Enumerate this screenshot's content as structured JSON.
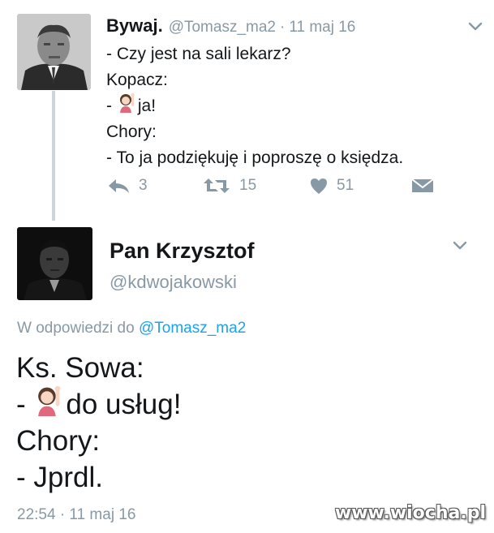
{
  "colors": {
    "text": "#14171a",
    "muted": "#8899a6",
    "link": "#1da1f2",
    "thread_line": "#ccd6dd"
  },
  "parent_tweet": {
    "display_name": "Bywaj.",
    "handle": "@Tomasz_ma2",
    "separator": "·",
    "date": "11 maj 16",
    "lines": [
      "- Czy jest na sali lekarz?",
      "Kopacz:",
      "ja!",
      "Chory:",
      "- To ja podziękuję i poproszę o księdza."
    ],
    "line3_prefix": "-",
    "emoji_icon": "woman-raising-hand-emoji",
    "actions": {
      "reply_count": "3",
      "retweet_count": "15",
      "like_count": "51"
    }
  },
  "reply_tweet": {
    "display_name": "Pan Krzysztof",
    "handle": "@kdwojakowski",
    "reply_prefix": "W odpowiedzi do",
    "reply_mention": "@Tomasz_ma2",
    "lines": [
      "Ks. Sowa:",
      "do usług!",
      "Chory:",
      "- Jprdl."
    ],
    "line2_prefix": "-",
    "emoji_icon": "woman-raising-hand-emoji",
    "timestamp": "22:54 · 11 maj 16"
  },
  "watermark": "www.wiocha.pl"
}
